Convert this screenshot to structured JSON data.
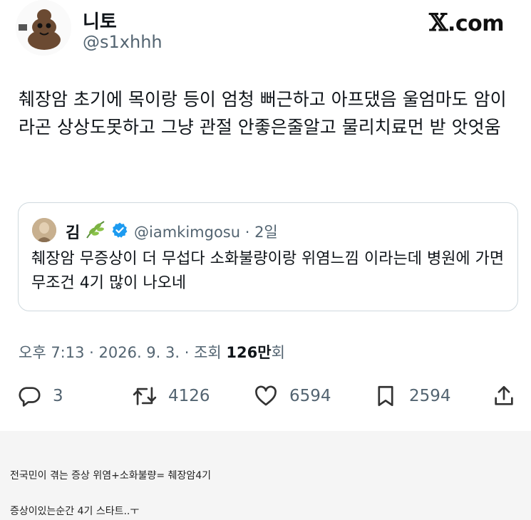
{
  "author": {
    "display_name": "니토",
    "handle": "@s1xhhh"
  },
  "site_logo": {
    "x": "𝕏",
    "suffix": ".com"
  },
  "tweet": {
    "text": "췌장암 초기에 목이랑 등이 엄청 뻐근하고 아프댔음 울엄마도 암이라곤 상상도못하고 그냥 관절 안좋은줄알고 물리치료먼 받 앗엇움"
  },
  "quoted_tweet": {
    "display_name": "김",
    "handle_time": "@iamkimgosu · 2일",
    "text": "췌장암 무증상이 더 무섭다 소화불량이랑 위염느낌 이라는데 병원에 가면 무조건 4기 많이 나오네"
  },
  "meta": {
    "time_date": "오후 7:13 · 2026. 9. 3. · 조회",
    "views": "126만",
    "views_suffix": "회"
  },
  "actions": {
    "replies": "3",
    "retweets": "4126",
    "likes": "6594",
    "bookmarks": "2594"
  },
  "colors": {
    "text": "#0f1419",
    "secondary": "#536471",
    "border": "#cfd9de",
    "verified": "#1d9bf0",
    "page_bg": "#f5f5f5"
  },
  "icons": [
    "reply-icon",
    "retweet-icon",
    "like-icon",
    "bookmark-icon",
    "share-icon",
    "verified-icon",
    "leaf-icon"
  ],
  "footer": {
    "line1": "전국민이 겪는 증상 위염+소화불량= 췌장암4기",
    "line2": "증상이있는순간 4기 스타트..ㅜ"
  }
}
